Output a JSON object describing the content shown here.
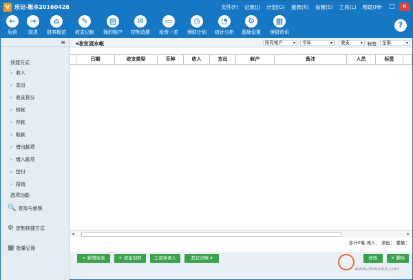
{
  "app": {
    "title": "乐记-账本20160428",
    "logo_char": "V"
  },
  "menu": [
    "文件(F)",
    "记账(J)",
    "计划(G)",
    "报表(R)",
    "设置(S)",
    "工具(L)",
    "帮助(H)"
  ],
  "window_buttons": {
    "minimize": "—",
    "maximize": "□",
    "close": "✕"
  },
  "toolbar": [
    {
      "label": "后退",
      "icon": "←",
      "name": "back"
    },
    {
      "label": "前进",
      "icon": "→",
      "name": "forward"
    },
    {
      "label": "财务概览",
      "icon": "⌂",
      "name": "overview"
    },
    {
      "label": "收支记帐",
      "icon": "✎",
      "name": "record"
    },
    {
      "label": "我的账户",
      "icon": "▤",
      "name": "accounts"
    },
    {
      "label": "控制消费",
      "icon": "✉",
      "name": "control"
    },
    {
      "label": "投资一览",
      "icon": "▭",
      "name": "invest"
    },
    {
      "label": "理财计划",
      "icon": "◷",
      "name": "plan"
    },
    {
      "label": "统计分析",
      "icon": "◔",
      "name": "stats"
    },
    {
      "label": "基础设置",
      "icon": "⚙",
      "name": "settings"
    },
    {
      "label": "理财资讯",
      "icon": "▦",
      "name": "news"
    }
  ],
  "help_icon": "?",
  "sidebar": {
    "menu_icon": "≡",
    "section1": "快捷方式",
    "items": [
      "收入",
      "支出",
      "收支拆分",
      "转帐",
      "存款",
      "取款",
      "借出款项",
      "借入款项",
      "垫付",
      "报销"
    ],
    "section2": "选项功能",
    "functions": [
      {
        "label": "查找与替换",
        "icon": "🔍"
      },
      {
        "label": "定制快捷方式",
        "icon": "⚙"
      },
      {
        "label": "批量记账",
        "icon": "▦"
      }
    ]
  },
  "filter": {
    "title": "▾收支流水帐",
    "account": "所有帐户",
    "period": "今年",
    "type": "收支",
    "tag_label": "标签",
    "tag_value": "全部"
  },
  "table": {
    "columns": [
      "日期",
      "收支类型",
      "币种",
      "收入",
      "支出",
      "帐户",
      "备注",
      "人员",
      "标签"
    ]
  },
  "scroll": {
    "left": "◂",
    "right": "▸"
  },
  "totals": "合计0笔 流入： 流出： 差额：",
  "bottom_buttons": [
    {
      "label": "+ 新增收支"
    },
    {
      "label": "+ 资金划转"
    },
    {
      "label": "工资单录入"
    },
    {
      "label": "其它记账 ▾"
    },
    {
      "label": "修改"
    },
    {
      "label": "✕ 删除"
    }
  ],
  "watermark": "www.downxia.com"
}
